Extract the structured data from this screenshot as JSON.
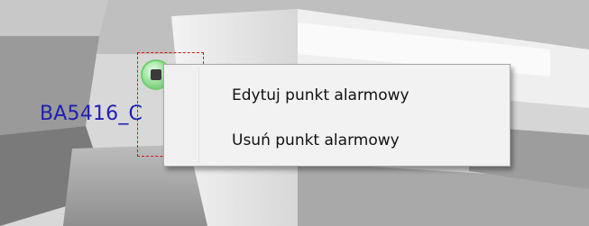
{
  "scene": {
    "point_label": "BA5416_C"
  },
  "context_menu": {
    "items": [
      {
        "label": "Edytuj punkt alarmowy"
      },
      {
        "label": "Usuń punkt alarmowy"
      }
    ]
  },
  "colors": {
    "label": "#1f1fb4",
    "selection": "#d01a1a",
    "marker": "#8fdc8f",
    "menu_bg": "#f2f2f2"
  }
}
